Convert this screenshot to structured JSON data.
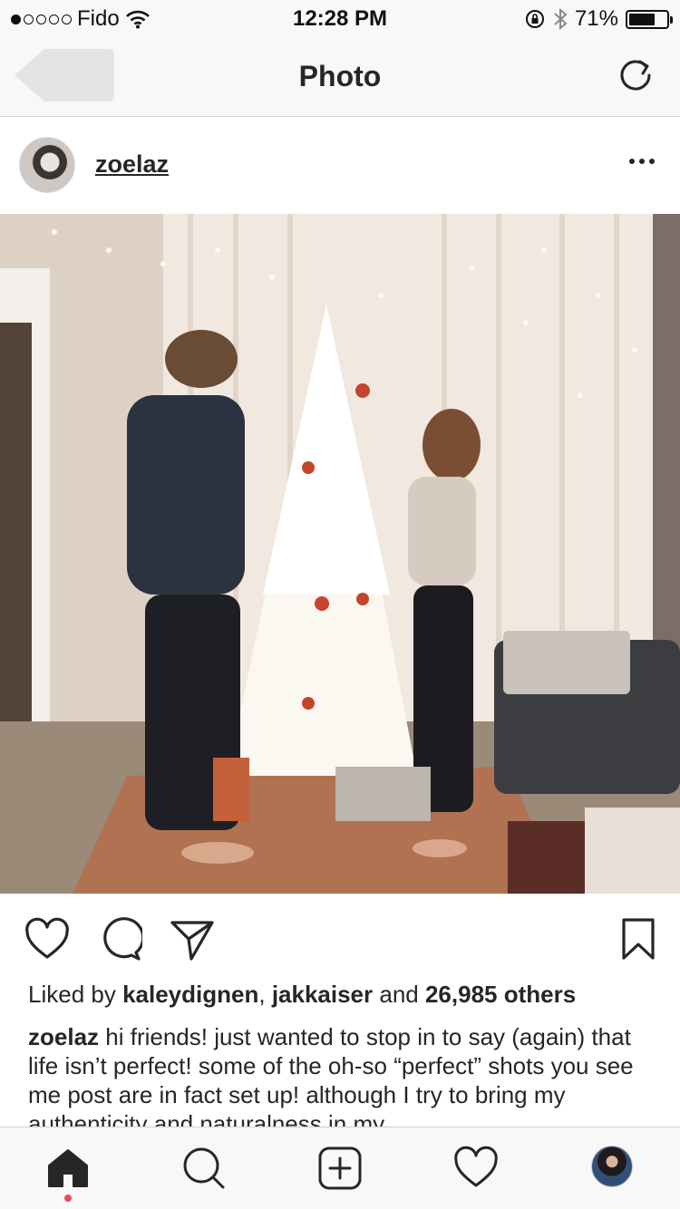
{
  "status_bar": {
    "carrier": "Fido",
    "time": "12:28 PM",
    "battery": "71%",
    "signal_bars": 1,
    "icons": [
      "wifi-icon",
      "orientation-lock-icon",
      "bluetooth-icon",
      "battery-icon"
    ]
  },
  "nav": {
    "title": "Photo",
    "back_icon": "back-arrow-icon",
    "refresh_icon": "refresh-icon"
  },
  "post": {
    "username": "zoelaz",
    "more_icon": "more-icon",
    "photo_alt": "Couple decorating a white Christmas tree",
    "likes": {
      "prefix": "Liked by ",
      "user1": "kaleydignen",
      "separator": ", ",
      "user2": "jakkaiser",
      "conjunction": " and ",
      "others": "26,985 others"
    },
    "caption": {
      "username": "zoelaz",
      "text": " hi friends! just wanted to stop in to say (again) that life isn’t perfect! some of the oh-so “perfect” shots you see me post are in fact set up! although I try to bring my authenticity and naturalness in my"
    }
  },
  "actions": [
    "heart-icon",
    "comment-icon",
    "share-icon",
    "bookmark-icon"
  ],
  "tabs": [
    "home-icon",
    "search-icon",
    "add-icon",
    "activity-icon",
    "profile-avatar"
  ],
  "colors": {
    "bar_bg": "#f8f8f8",
    "text": "#262626",
    "notification_dot": "#ed4956"
  }
}
